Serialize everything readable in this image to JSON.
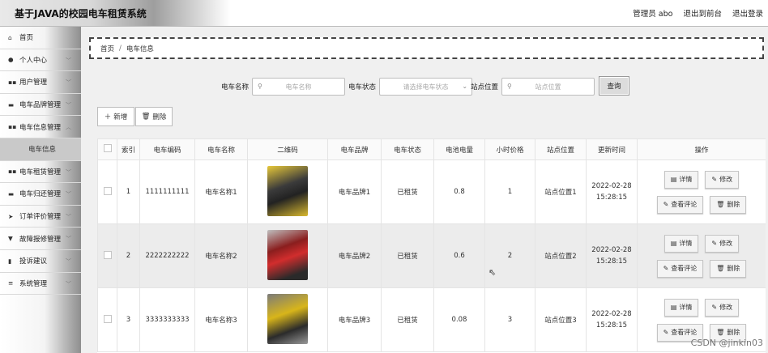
{
  "header": {
    "title": "基于JAVA的校园电车租赁系统",
    "admin": "管理员 abo",
    "to_front": "退出到前台",
    "logout": "退出登录"
  },
  "sidebar": {
    "items": [
      {
        "label": "首页",
        "icon": "home-icon",
        "glyph": "⌂",
        "arrow": false
      },
      {
        "label": "个人中心",
        "icon": "user-icon",
        "glyph": "●",
        "arrow": true
      },
      {
        "label": "用户管理",
        "icon": "grid-icon",
        "glyph": "▪▪",
        "arrow": true
      },
      {
        "label": "电车品牌管理",
        "icon": "shop-icon",
        "glyph": "▬",
        "arrow": true
      },
      {
        "label": "电车信息管理",
        "icon": "grid-icon",
        "glyph": "▪▪",
        "arrow": true
      },
      {
        "label": "电车信息",
        "sub": true
      },
      {
        "label": "电车租赁管理",
        "icon": "grid-icon",
        "glyph": "▪▪",
        "arrow": true
      },
      {
        "label": "电车归还管理",
        "icon": "monitor-icon",
        "glyph": "▬",
        "arrow": true
      },
      {
        "label": "订单评价管理",
        "icon": "send-icon",
        "glyph": "➤",
        "arrow": true
      },
      {
        "label": "故障报修管理",
        "icon": "trophy-icon",
        "glyph": "▼",
        "arrow": true
      },
      {
        "label": "投诉建议",
        "icon": "clipboard-icon",
        "glyph": "▮",
        "arrow": true
      },
      {
        "label": "系统管理",
        "icon": "list-icon",
        "glyph": "≡",
        "arrow": true
      }
    ]
  },
  "breadcrumb": {
    "home": "首页",
    "sep": "/",
    "current": "电车信息"
  },
  "search": {
    "name_label": "电车名称",
    "name_placeholder": "电车名称",
    "status_label": "电车状态",
    "status_placeholder": "请选择电车状态",
    "location_label": "站点位置",
    "location_placeholder": "站点位置",
    "query_label": "查询"
  },
  "toolbar": {
    "add_label": "新增",
    "delete_label": "删除"
  },
  "table": {
    "columns": [
      "",
      "索引",
      "电车编码",
      "电车名称",
      "二维码",
      "电车品牌",
      "电车状态",
      "电池电量",
      "小时价格",
      "站点位置",
      "更新时间",
      "操作"
    ],
    "rows": [
      {
        "index": "1",
        "code": "1111111111",
        "name": "电车名称1",
        "brand": "电车品牌1",
        "status": "已租赁",
        "battery": "0.8",
        "price": "1",
        "location": "站点位置1",
        "time": "2022-02-28 15:28:15"
      },
      {
        "index": "2",
        "code": "2222222222",
        "name": "电车名称2",
        "brand": "电车品牌2",
        "status": "已租赁",
        "battery": "0.6",
        "price": "2",
        "location": "站点位置2",
        "time": "2022-02-28 15:28:15"
      },
      {
        "index": "3",
        "code": "3333333333",
        "name": "电车名称3",
        "brand": "电车品牌3",
        "status": "已租赁",
        "battery": "0.08",
        "price": "3",
        "location": "站点位置3",
        "time": "2022-02-28 15:28:15"
      }
    ],
    "actions": {
      "detail": "详情",
      "edit": "修改",
      "review": "查看评论",
      "delete": "删除"
    }
  },
  "watermark": "CSDN @jinkin03"
}
